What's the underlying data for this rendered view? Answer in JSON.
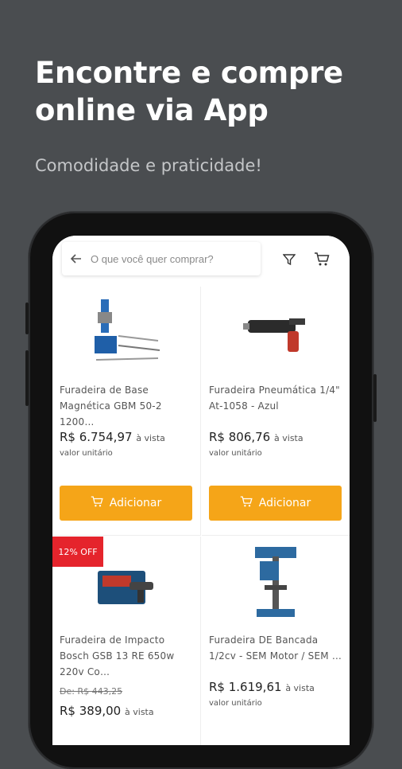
{
  "promo": {
    "headline": "Encontre e compre online via App",
    "subline": "Comodidade e praticidade!"
  },
  "app": {
    "search_placeholder": "O que você quer comprar?",
    "icons": [
      "back-arrow-icon",
      "filter-icon",
      "cart-icon"
    ]
  },
  "products": [
    {
      "name": "Furadeira de Base Magnética GBM 50-2 1200…",
      "price": "R$ 6.754,97",
      "price_suffix": "à vista",
      "unit_note": "valor unitário",
      "add_label": "Adicionar"
    },
    {
      "name": "Furadeira Pneumática  1/4\" At-1058 - Azul",
      "price": "R$ 806,76",
      "price_suffix": "à vista",
      "unit_note": "valor unitário",
      "add_label": "Adicionar"
    },
    {
      "badge": "12% OFF",
      "name": "Furadeira de Impacto Bosch GSB 13 RE 650w 220v Co…",
      "old_price": "De: R$ 443,25",
      "price": "R$ 389,00",
      "price_suffix": "à vista"
    },
    {
      "name": "Furadeira DE Bancada 1/2cv - SEM Motor / SEM …",
      "price": "R$ 1.619,61",
      "price_suffix": "à vista",
      "unit_note": "valor unitário"
    }
  ],
  "colors": {
    "background": "#4a4d50",
    "accent": "#f5a518",
    "badge": "#e5242c"
  }
}
